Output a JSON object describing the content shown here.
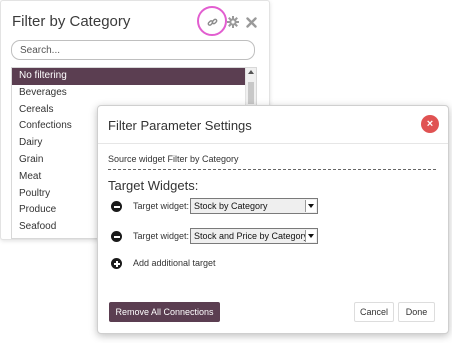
{
  "widget": {
    "title": "Filter by Category",
    "search_placeholder": "Search...",
    "items": [
      {
        "label": "No filtering",
        "selected": true
      },
      {
        "label": "Beverages"
      },
      {
        "label": "Cereals"
      },
      {
        "label": "Confections"
      },
      {
        "label": "Dairy"
      },
      {
        "label": "Grain"
      },
      {
        "label": "Meat"
      },
      {
        "label": "Poultry"
      },
      {
        "label": "Produce"
      },
      {
        "label": "Seafood"
      }
    ],
    "icons": [
      "link-icon",
      "gear-icon",
      "close-icon"
    ],
    "accent_color": "#5b3e51",
    "highlight_color": "#e25ed0"
  },
  "dialog": {
    "title": "Filter Parameter Settings",
    "close_icon": "×",
    "source_text": "Source widget Filter by Category",
    "target_heading": "Target Widgets:",
    "targets": [
      {
        "label": "Target widget:",
        "value": "Stock by Category"
      },
      {
        "label": "Target widget:",
        "value": "Stock and Price by Category"
      }
    ],
    "add_label": "Add additional target",
    "remove_all_label": "Remove All Connections",
    "cancel_label": "Cancel",
    "done_label": "Done",
    "close_color": "#e05252"
  }
}
